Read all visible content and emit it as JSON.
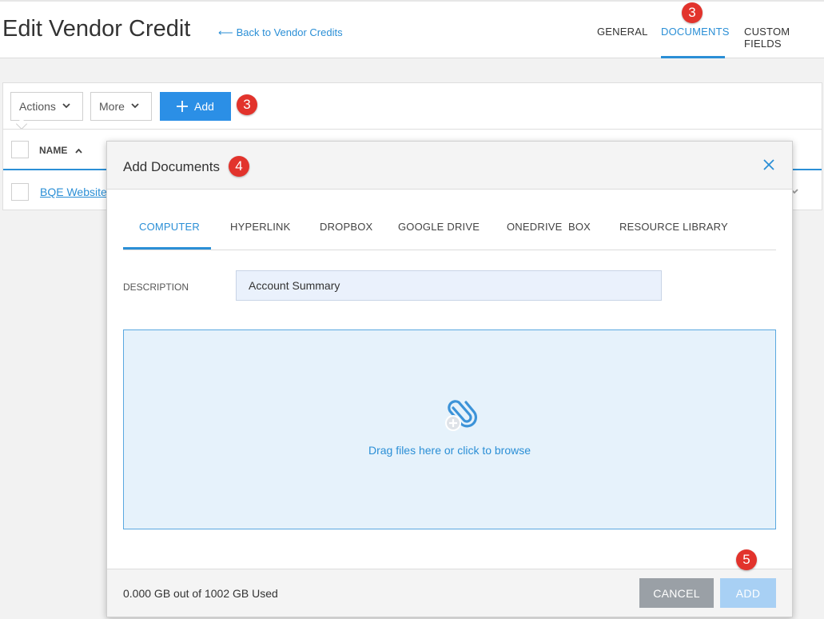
{
  "header": {
    "title": "Edit Vendor Credit",
    "back_arrow": "⟵",
    "back_label": "Back to Vendor Credits",
    "tabs": [
      {
        "label": "GENERAL"
      },
      {
        "label": "DOCUMENTS"
      },
      {
        "label": "CUSTOM FIELDS"
      }
    ],
    "active_tab": "DOCUMENTS"
  },
  "badges": {
    "documents_tab": "3",
    "add_button": "3",
    "modal_title": "4",
    "add_doc_button": "5"
  },
  "toolbar": {
    "actions_label": "Actions",
    "more_label": "More",
    "add_label": "Add"
  },
  "table": {
    "columns": [
      {
        "label": "NAME",
        "sort": "ascending"
      }
    ],
    "rows": [
      {
        "name": "BQE Website"
      }
    ]
  },
  "modal": {
    "title": "Add Documents",
    "tabs": [
      {
        "label": "COMPUTER"
      },
      {
        "label": "HYPERLINK"
      },
      {
        "label": "DROPBOX"
      },
      {
        "label": "GOOGLE DRIVE"
      },
      {
        "label": "ONEDRIVE"
      },
      {
        "label": "BOX"
      },
      {
        "label": "RESOURCE LIBRARY"
      }
    ],
    "active_tab": "COMPUTER",
    "description_label": "DESCRIPTION",
    "description_value": "Account Summary",
    "dropzone_text": "Drag files here or click to browse",
    "usage_text": "0.000 GB out of 1002 GB Used",
    "cancel_label": "CANCEL",
    "add_label": "ADD"
  },
  "colors": {
    "accent": "#2b8fd6",
    "badge": "#e2332c",
    "cancel": "#9aa0a6",
    "add_disabled": "#a8d0f4"
  },
  "icons": [
    "back-arrow-icon",
    "chevron-down-icon",
    "plus-icon",
    "sort-up-icon",
    "close-icon",
    "paperclip-add-icon"
  ]
}
